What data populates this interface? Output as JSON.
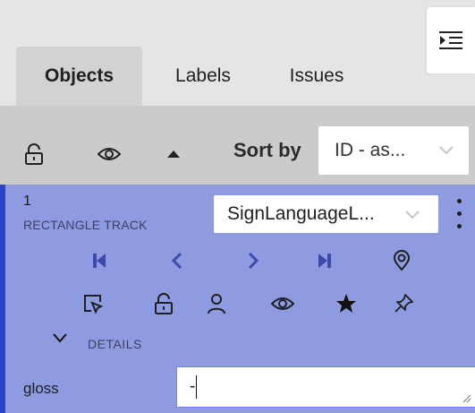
{
  "tabs": [
    {
      "label": "Objects",
      "active": true
    },
    {
      "label": "Labels",
      "active": false
    },
    {
      "label": "Issues",
      "active": false
    }
  ],
  "toolbar": {
    "sort_label": "Sort by",
    "sort_value": "ID - as..."
  },
  "track": {
    "id": "1",
    "type": "RECTANGLE TRACK",
    "label_value": "SignLanguageL...",
    "details_label": "DETAILS",
    "attribute_name": "gloss",
    "attribute_value": "-"
  },
  "icons": {
    "panel_toggle": "collapse-sidebar-icon",
    "toolbar": [
      "lock-open-icon",
      "eye-icon",
      "caret-up-icon"
    ],
    "navigation": [
      "first-frame-icon",
      "previous-icon",
      "next-icon",
      "last-frame-icon",
      "location-pin-icon"
    ],
    "actions": [
      "select-region-icon",
      "lock-open-icon",
      "person-icon",
      "eye-icon",
      "star-icon",
      "pin-icon"
    ]
  },
  "colors": {
    "card_background": "#8f9be1",
    "card_accent": "#2c44c8",
    "input_border": "#6d83f2"
  }
}
